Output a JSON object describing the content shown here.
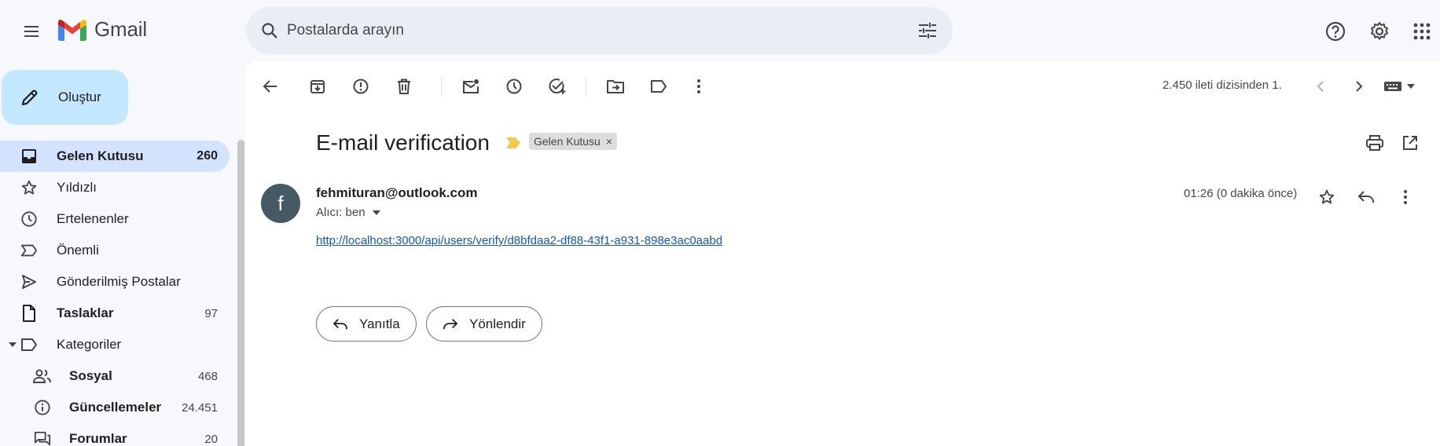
{
  "app": {
    "name": "Gmail"
  },
  "search": {
    "placeholder": "Postalarda arayın"
  },
  "compose": {
    "label": "Oluştur"
  },
  "nav": {
    "items": [
      {
        "label": "Gelen Kutusu",
        "count": "260"
      },
      {
        "label": "Yıldızlı",
        "count": ""
      },
      {
        "label": "Ertelenenler",
        "count": ""
      },
      {
        "label": "Önemli",
        "count": ""
      },
      {
        "label": "Gönderilmiş Postalar",
        "count": ""
      },
      {
        "label": "Taslaklar",
        "count": "97"
      },
      {
        "label": "Kategoriler",
        "count": ""
      },
      {
        "label": "Sosyal",
        "count": "468"
      },
      {
        "label": "Güncellemeler",
        "count": "24.451"
      },
      {
        "label": "Forumlar",
        "count": "20"
      }
    ]
  },
  "toolbar": {
    "pagination": "2.450 ileti dizisinden 1."
  },
  "email": {
    "subject": "E-mail verification",
    "label_chip": "Gelen Kutusu",
    "label_chip_remove": "×",
    "avatar_letter": "f",
    "sender": "fehmituran@outlook.com",
    "to": "Alıcı: ben",
    "time": "01:26 (0 dakika önce)",
    "link": "http://localhost:3000/api/users/verify/d8bfdaa2-df88-43f1-a931-898e3ac0aabd"
  },
  "actions": {
    "reply": "Yanıtla",
    "forward": "Yönlendir"
  },
  "colors": {
    "background": "#f6f8fc",
    "compose_bg": "#c2e7ff",
    "active_nav": "#d3e3fd",
    "search_bg": "#e9eef6",
    "avatar_bg": "#455a64",
    "link": "#1155cc",
    "importance_marker": "#f2c94c"
  }
}
